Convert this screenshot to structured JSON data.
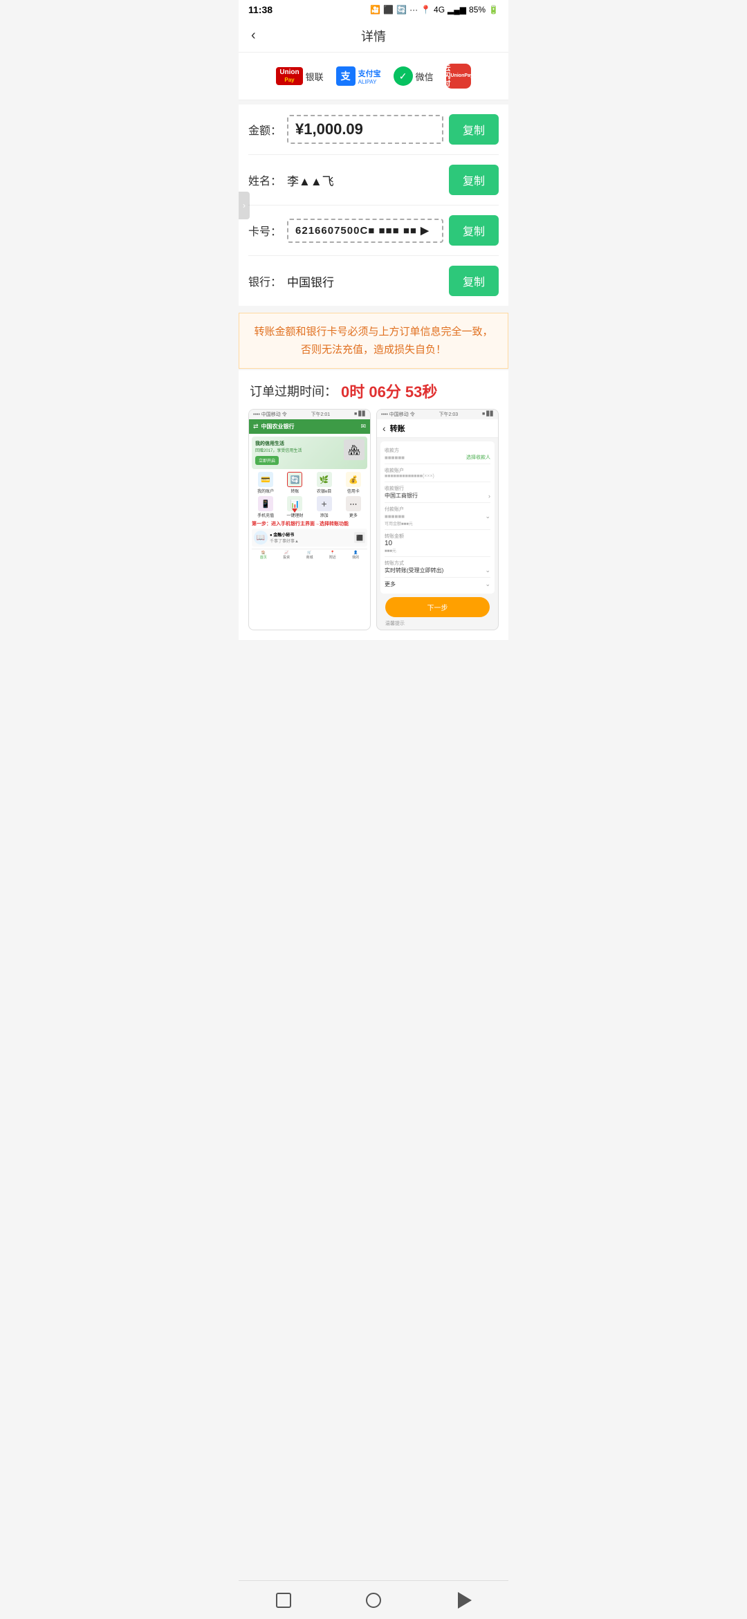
{
  "statusBar": {
    "time": "11:38",
    "battery": "85%",
    "signal": "4G"
  },
  "header": {
    "title": "详情",
    "backLabel": "‹"
  },
  "paymentMethods": [
    {
      "id": "unionpay",
      "label": "银联"
    },
    {
      "id": "alipay",
      "label": "支付宝",
      "sublabel": "ALIPAY"
    },
    {
      "id": "wechat",
      "label": "微信"
    },
    {
      "id": "yunshan",
      "label": "云闪付"
    }
  ],
  "fields": {
    "amount": {
      "label": "金额：",
      "prefix": "¥",
      "value": "1,000.09",
      "copyLabel": "复制"
    },
    "name": {
      "label": "姓名：",
      "value": "李▲▲飞",
      "copyLabel": "复制"
    },
    "card": {
      "label": "卡号：",
      "value": "6216607500C■ ■■■ ■■ ▶",
      "copyLabel": "复制"
    },
    "bank": {
      "label": "银行：",
      "value": "中国银行",
      "copyLabel": "复制"
    }
  },
  "warning": {
    "text": "转账金额和银行卡号必须与上方订单信息完全一致，\n否则无法充值，造成损失自负！"
  },
  "timer": {
    "label": "订单过期时间：",
    "value": "0时 06分 53秒"
  },
  "instruction": {
    "step1": "第一步：进入手机银行主界面→选择转账功能",
    "hint": "● 金融小秘书",
    "transferLabel": "转账"
  },
  "abcBank": {
    "name": "中国农业银行",
    "time": "下午2:01",
    "gridItems": [
      "我的账户",
      "转账",
      "农银e目",
      "信用卡",
      "手机充值",
      "一键理财",
      "添加",
      "更多"
    ]
  },
  "transferForm": {
    "title": "转账",
    "time": "下午2:03",
    "rows": [
      {
        "label": "收款方",
        "value": "■■■■■■",
        "action": "选择收款人"
      },
      {
        "label": "收款账户",
        "value": "■■■■■■■■■■■■■(×××)"
      },
      {
        "label": "收款银行",
        "value": "中国工商银行"
      },
      {
        "label": "付款账户",
        "value": "■■■■■■"
      },
      {
        "label": "转账金额",
        "value": "10"
      },
      {
        "label": "转账方式",
        "value": "实时转账(受理立即转出)"
      }
    ],
    "moreLabel": "更多",
    "nextBtn": "下一步",
    "tipLabel": "温馨提示"
  }
}
